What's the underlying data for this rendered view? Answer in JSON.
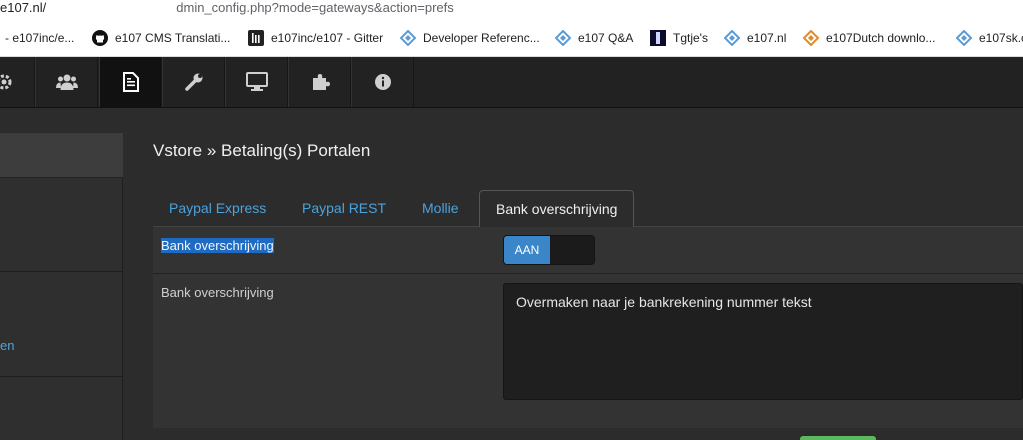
{
  "browser": {
    "url_host": "e107.nl/",
    "url_path": "dmin_config.php?mode=gateways&action=prefs",
    "bookmarks": [
      {
        "label": "- e107inc/e...",
        "icon": "folder-icon"
      },
      {
        "label": "e107 CMS Translati...",
        "icon": "github-icon"
      },
      {
        "label": "e107inc/e107 - Gitter",
        "icon": "gitter-icon"
      },
      {
        "label": "Developer Referenc...",
        "icon": "e107-diamond-icon"
      },
      {
        "label": "e107 Q&A",
        "icon": "e107-diamond-icon"
      },
      {
        "label": "Tgtje's",
        "icon": "tgtje-icon"
      },
      {
        "label": "e107.nl",
        "icon": "e107-diamond-icon"
      },
      {
        "label": "e107Dutch downlo...",
        "icon": "e107-orange-diamond-icon"
      },
      {
        "label": "e107sk.c",
        "icon": "e107-diamond-icon"
      }
    ]
  },
  "navbar": {
    "items": [
      {
        "icon": "gear-icon"
      },
      {
        "icon": "users-icon"
      },
      {
        "icon": "content-icon",
        "active": true
      },
      {
        "icon": "wrench-icon"
      },
      {
        "icon": "monitor-icon"
      },
      {
        "icon": "puzzle-icon"
      },
      {
        "icon": "info-icon"
      }
    ]
  },
  "sidebar": {
    "link_label": "en"
  },
  "main": {
    "title": "Vstore » Betaling(s) Portalen",
    "tabs": [
      {
        "label": "Paypal Express",
        "active": false
      },
      {
        "label": "Paypal REST",
        "active": false
      },
      {
        "label": "Mollie",
        "active": false
      },
      {
        "label": "Bank overschrijving",
        "active": true
      }
    ],
    "rows": {
      "toggle_label": "Bank overschrijving",
      "toggle_value": "AAN",
      "text_label": "Bank overschrijving",
      "text_value": "Overmaken naar je bankrekening nummer tekst"
    }
  },
  "colors": {
    "accent": "#4aa3df",
    "toggle_on": "#3a86c8",
    "selection": "#1e6bc4"
  }
}
